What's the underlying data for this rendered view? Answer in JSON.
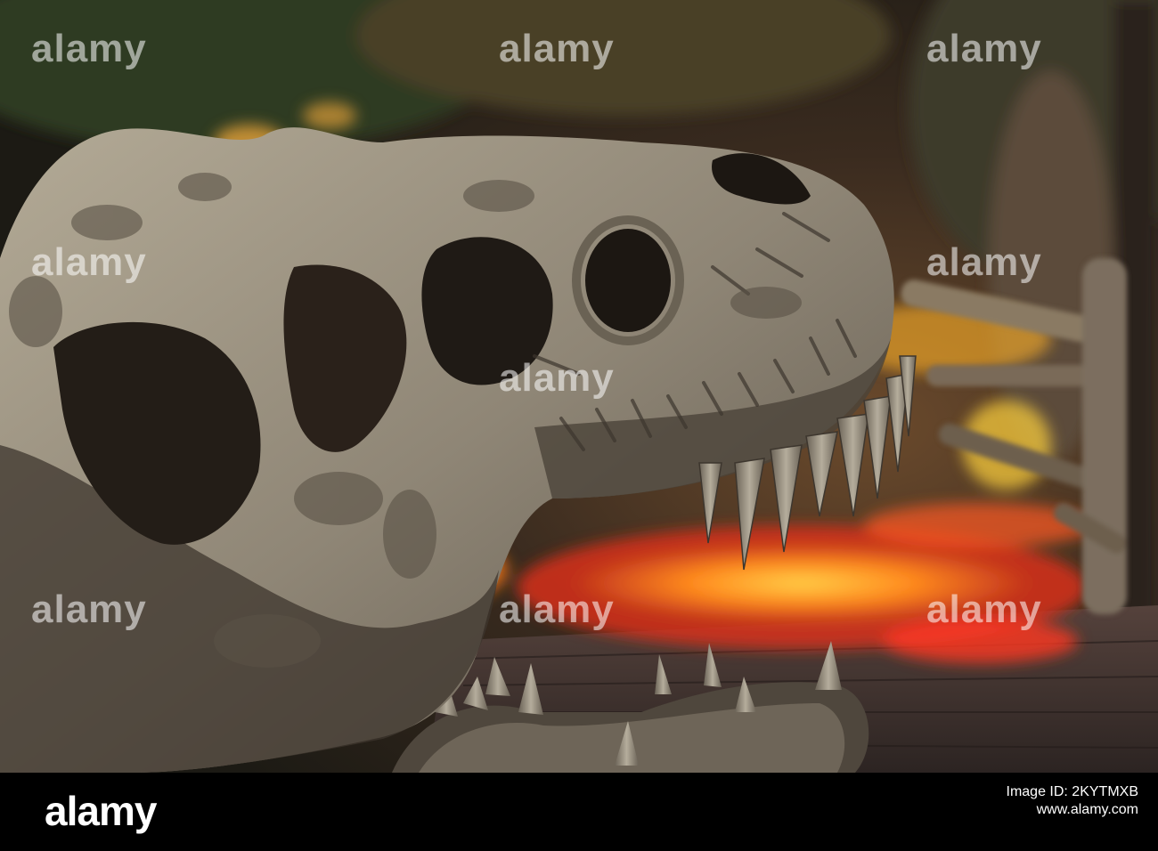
{
  "photo": {
    "subject": "tyrannosaurus-skull-replica",
    "colors": {
      "bone": "#9a9180",
      "bone_shadow": "#3d362e",
      "glow_orange": "#ff8a1e",
      "glow_red": "#e0301a",
      "floor": "#3b2f2c"
    }
  },
  "watermarks": [
    "alamy",
    "alamy",
    "alamy",
    "alamy",
    "alamy",
    "alamy",
    "alamy",
    "alamy",
    "alamy"
  ],
  "footer": {
    "brand": "alamy",
    "image_id_label": "Image ID: 2KYTMXB",
    "url": "www.alamy.com"
  }
}
